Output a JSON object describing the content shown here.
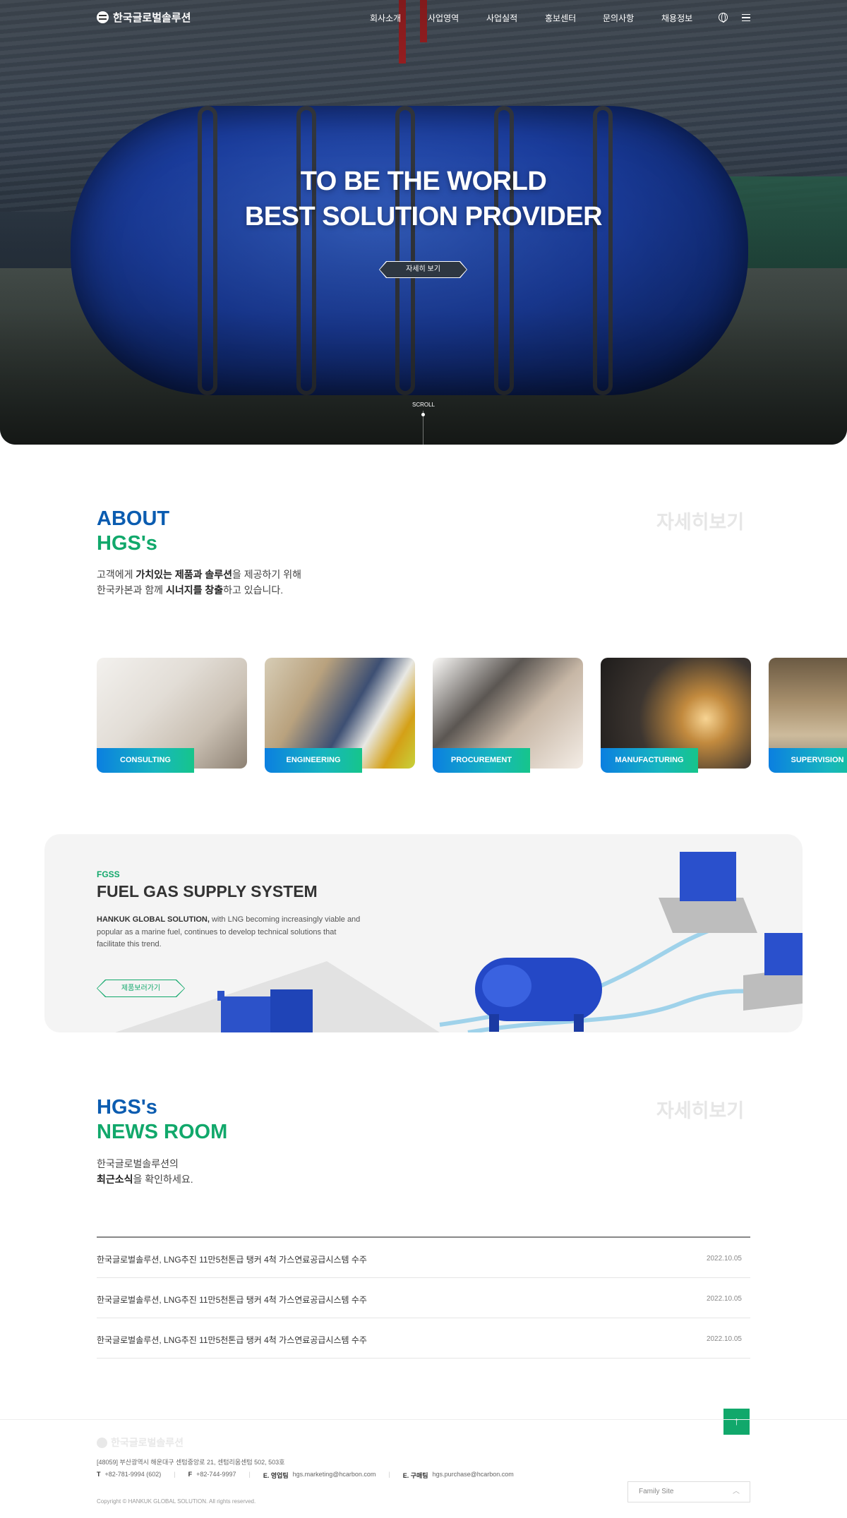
{
  "header": {
    "logo_text": "한국글로벌솔루션",
    "nav": [
      "회사소개",
      "사업영역",
      "사업실적",
      "홍보센터",
      "문의사항",
      "채용정보"
    ]
  },
  "hero": {
    "title_line1": "TO BE THE WORLD",
    "title_line2": "BEST SOLUTION PROVIDER",
    "button_label": "자세히 보기",
    "scroll_label": "SCROLL"
  },
  "about": {
    "title_line1": "ABOUT",
    "title_line2": "HGS's",
    "more_label": "자세히보기",
    "desc1_pre": "고객에게 ",
    "desc1_bold": "가치있는 제품과 솔루션",
    "desc1_post": "을 제공하기 위해",
    "desc2_pre": "한국카본과 함께 ",
    "desc2_bold": "시너지를 창출",
    "desc2_post": "하고 있습니다."
  },
  "services": [
    {
      "label": "CONSULTING"
    },
    {
      "label": "ENGINEERING"
    },
    {
      "label": "PROCUREMENT"
    },
    {
      "label": "MANUFACTURING"
    },
    {
      "label": "SUPERVISION"
    }
  ],
  "fgss": {
    "kicker": "FGSS",
    "title": "FUEL GAS SUPPLY SYSTEM",
    "desc_bold": "HANKUK GLOBAL SOLUTION,",
    "desc_rest": " with LNG becoming increasingly viable and popular as a marine fuel, continues to develop technical solutions that facilitate this trend.",
    "button_label": "제품보러가기"
  },
  "news": {
    "title_line1": "HGS's",
    "title_line2": "NEWS ROOM",
    "more_label": "자세히보기",
    "desc1": "한국글로벌솔루션의",
    "desc2_bold": "최근소식",
    "desc2_post": "을 확인하세요.",
    "items": [
      {
        "title": "한국글로벌솔루션, LNG추진 11만5천톤급 탱커 4척 가스연료공급시스템 수주",
        "date": "2022.10.05"
      },
      {
        "title": "한국글로벌솔루션, LNG추진 11만5천톤급 탱커 4척 가스연료공급시스템 수주",
        "date": "2022.10.05"
      },
      {
        "title": "한국글로벌솔루션, LNG추진 11만5천톤급 탱커 4척 가스연료공급시스템 수주",
        "date": "2022.10.05"
      }
    ]
  },
  "footer": {
    "logo_text": "한국글로벌솔루션",
    "address": "[48059] 부산광역시 해운대구 센텀중앙로 21, 센텀리움센텀 502, 503호",
    "tel_label": "T",
    "tel": "+82-781-9994 (602)",
    "fax_label": "F",
    "fax": "+82-744-9997",
    "sales_label": "E. 영업팀",
    "sales_email": "hgs.marketing@hcarbon.com",
    "purchase_label": "E. 구매팀",
    "purchase_email": "hgs.purchase@hcarbon.com",
    "copyright": "Copyright © HANKUK GLOBAL SOLUTION. All rights reserved.",
    "family_site": "Family Site",
    "top_button": "↑"
  },
  "colors": {
    "brand_blue": "#0b5cb0",
    "brand_green": "#11a86b",
    "tag_gradient_start": "#0b7fe0",
    "tag_gradient_end": "#16c58b"
  }
}
